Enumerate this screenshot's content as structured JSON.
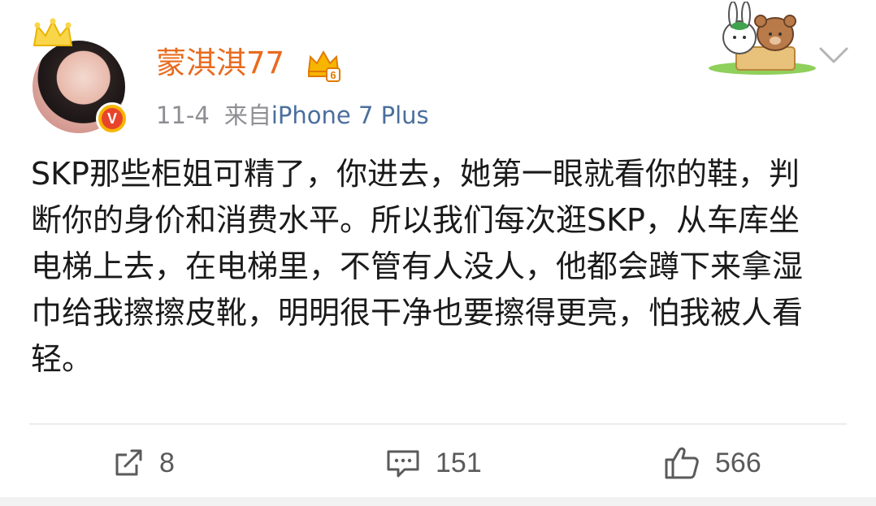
{
  "post": {
    "username": "蒙淇淇77",
    "date": "11-4",
    "source_label": "来自",
    "source_device": "iPhone 7 Plus",
    "verified_letter": "V",
    "vip_level": "6",
    "content": "SKP那些柜姐可精了，你进去，她第一眼就看你的鞋，判断你的身价和消费水平。所以我们每次逛SKP，从车库坐电梯上去，在电梯里，不管有人没人，他都会蹲下来拿湿巾给我擦擦皮靴，明明很干净也要擦得更亮，怕我被人看轻。"
  },
  "actions": {
    "repost_count": "8",
    "comment_count": "151",
    "like_count": "566"
  },
  "icons": {
    "crown": "crown-icon",
    "vip": "vip-crown-icon",
    "verified": "verified-badge-icon",
    "more": "chevron-down-icon",
    "repost": "repost-icon",
    "comment": "comment-icon",
    "like": "thumbs-up-icon"
  },
  "colors": {
    "username": "#e86b1f",
    "meta": "#8e8e93",
    "device_link": "#4a6f9c",
    "text": "#1a1a1a",
    "verified_bg": "#e8442c",
    "verified_ring": "#f7b500"
  }
}
